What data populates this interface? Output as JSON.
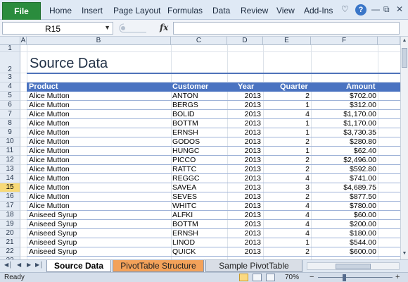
{
  "ribbon": {
    "file_label": "File",
    "tabs": [
      "Home",
      "Insert",
      "Page Layout",
      "Formulas",
      "Data",
      "Review",
      "View",
      "Add-Ins"
    ],
    "help_glyph": "?",
    "icons": [
      "heart-icon",
      "help-icon",
      "minimize-ribbon-icon",
      "restore-icon",
      "close-icon"
    ]
  },
  "formula_bar": {
    "name_box": "R15",
    "fx": "fx",
    "formula": ""
  },
  "columns": [
    "A",
    "B",
    "C",
    "D",
    "E",
    "F"
  ],
  "row_numbers": [
    "1",
    "2",
    "3",
    "4",
    "5",
    "6",
    "7",
    "8",
    "9",
    "10",
    "11",
    "12",
    "13",
    "14",
    "15",
    "16",
    "17",
    "18",
    "19",
    "20",
    "21",
    "22",
    "23"
  ],
  "active_row": "15",
  "sheet": {
    "title": "Source Data",
    "headers": [
      "Product",
      "Customer",
      "Year",
      "Quarter",
      "Amount"
    ],
    "rows": [
      [
        "Alice Mutton",
        "ANTON",
        "2013",
        "2",
        "$702.00"
      ],
      [
        "Alice Mutton",
        "BERGS",
        "2013",
        "1",
        "$312.00"
      ],
      [
        "Alice Mutton",
        "BOLID",
        "2013",
        "4",
        "$1,170.00"
      ],
      [
        "Alice Mutton",
        "BOTTM",
        "2013",
        "1",
        "$1,170.00"
      ],
      [
        "Alice Mutton",
        "ERNSH",
        "2013",
        "1",
        "$3,730.35"
      ],
      [
        "Alice Mutton",
        "GODOS",
        "2013",
        "2",
        "$280.80"
      ],
      [
        "Alice Mutton",
        "HUNGC",
        "2013",
        "1",
        "$62.40"
      ],
      [
        "Alice Mutton",
        "PICCO",
        "2013",
        "2",
        "$2,496.00"
      ],
      [
        "Alice Mutton",
        "RATTC",
        "2013",
        "2",
        "$592.80"
      ],
      [
        "Alice Mutton",
        "REGGC",
        "2013",
        "4",
        "$741.00"
      ],
      [
        "Alice Mutton",
        "SAVEA",
        "2013",
        "3",
        "$4,689.75"
      ],
      [
        "Alice Mutton",
        "SEVES",
        "2013",
        "2",
        "$877.50"
      ],
      [
        "Alice Mutton",
        "WHITC",
        "2013",
        "4",
        "$780.00"
      ],
      [
        "Aniseed Syrup",
        "ALFKI",
        "2013",
        "4",
        "$60.00"
      ],
      [
        "Aniseed Syrup",
        "BOTTM",
        "2013",
        "4",
        "$200.00"
      ],
      [
        "Aniseed Syrup",
        "ERNSH",
        "2013",
        "4",
        "$180.00"
      ],
      [
        "Aniseed Syrup",
        "LINOD",
        "2013",
        "1",
        "$544.00"
      ],
      [
        "Aniseed Syrup",
        "QUICK",
        "2013",
        "2",
        "$600.00"
      ]
    ]
  },
  "sheet_tabs": [
    "Source Data",
    "PivotTable Structure",
    "Sample PivotTable"
  ],
  "status": {
    "text": "Ready",
    "zoom": "70%",
    "zoom_minus": "−",
    "zoom_plus": "+"
  },
  "colors": {
    "header_blue": "#4a73c1",
    "file_tab_green": "#2a8c3d",
    "pivot_tab_orange": "#f3a25a",
    "active_row_yellow": "#f7d977"
  }
}
